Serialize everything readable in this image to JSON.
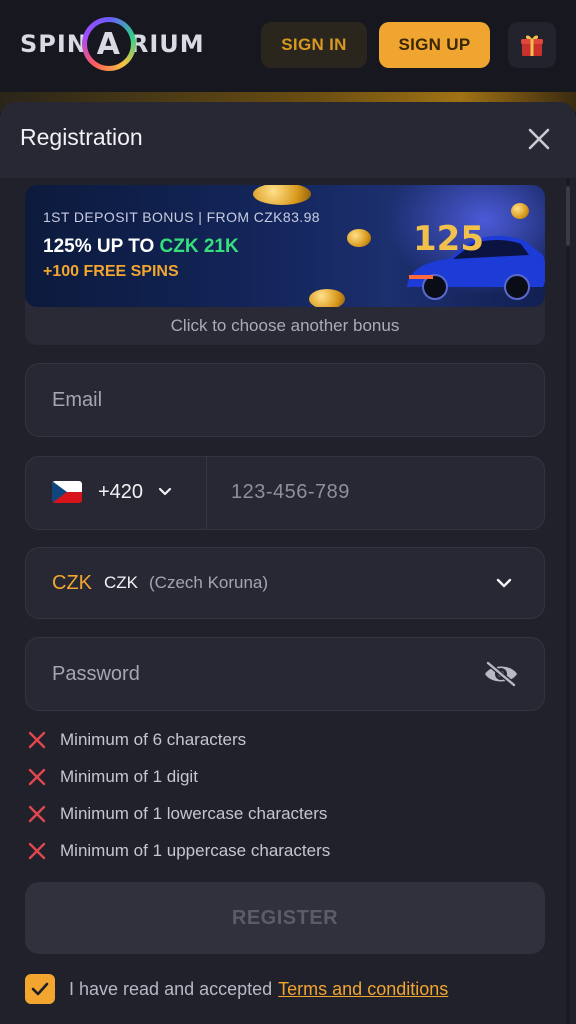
{
  "header": {
    "logo_left": "SPIN",
    "logo_ring_letter": "A",
    "logo_right": "RIUM",
    "sign_in": "SIGN IN",
    "sign_up": "SIGN UP"
  },
  "modal": {
    "title": "Registration"
  },
  "bonus": {
    "subtitle": "1ST DEPOSIT BONUS | FROM CZK83.98",
    "main_prefix": "125% UP TO ",
    "main_highlight": "CZK 21K",
    "spins": "+100 FREE SPINS",
    "badge": "125",
    "choose_label": "Click to choose another bonus"
  },
  "form": {
    "email_placeholder": "Email",
    "phone_code": "+420",
    "phone_placeholder": "123-456-789",
    "currency_code": "CZK",
    "currency_name": "CZK",
    "currency_full": "(Czech Koruna)",
    "password_placeholder": "Password"
  },
  "requirements": [
    "Minimum of 6 characters",
    "Minimum of 1 digit",
    "Minimum of 1 lowercase characters",
    "Minimum of 1 uppercase characters"
  ],
  "register_label": "REGISTER",
  "terms": {
    "text": "I have read and accepted",
    "link": "Terms and conditions",
    "checked": true
  },
  "colors": {
    "accent": "#f2a52f",
    "highlight_green": "#35e07c",
    "error_red": "#e0474c",
    "background": "#20212b"
  }
}
